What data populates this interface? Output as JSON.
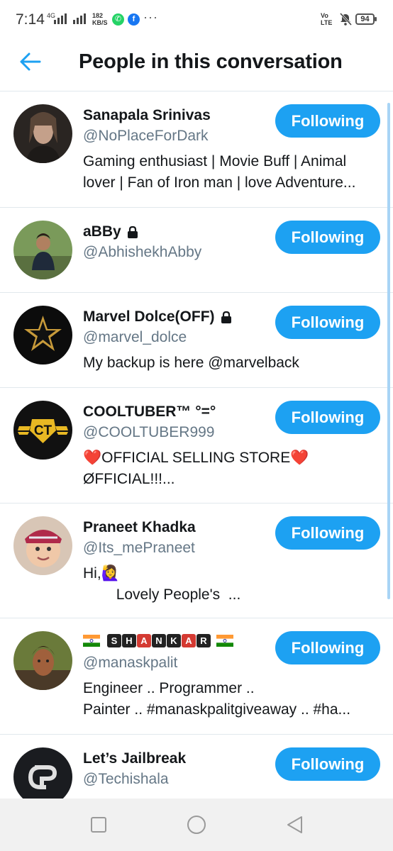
{
  "status_bar": {
    "time": "7:14",
    "network": "4G",
    "speed_value": "182",
    "speed_unit": "KB/S",
    "more": "···",
    "volte_top": "Vo",
    "volte_bottom": "LTE",
    "battery": "94",
    "icons": [
      "whatsapp-icon",
      "facebook-icon",
      "mute-icon",
      "battery-icon"
    ]
  },
  "header": {
    "title": "People in this conversation",
    "back_icon": "arrow-left-icon"
  },
  "accent_color": "#1da1f2",
  "people": [
    {
      "name": "Sanapala Srinivas",
      "handle": "@NoPlaceForDark",
      "bio": "Gaming enthusiast | Movie Buff | Animal\nlover | Fan of Iron man | love Adventure...",
      "button": "Following",
      "protected": false
    },
    {
      "name": "aBBy",
      "handle": "@AbhishekhAbby",
      "bio": "",
      "button": "Following",
      "protected": true
    },
    {
      "name": "Marvel Dolce(OFF)",
      "handle": "@marvel_dolce",
      "bio": "My backup is here @marvelback",
      "button": "Following",
      "protected": true
    },
    {
      "name": "COOLTUBER™ °=°",
      "handle": "@COOLTUBER999",
      "bio": "❤️OFFICIAL SELLING STORE❤️\nØFFICIAL!!!...",
      "button": "Following",
      "protected": false
    },
    {
      "name": "Praneet Khadka",
      "handle": "@Its_mePraneet",
      "bio": "Hi,🙋‍♀️\n        Lovely People's  ...",
      "button": "Following",
      "protected": false
    },
    {
      "name_letters": [
        "S",
        "H",
        "A",
        "N",
        "K",
        "A",
        "R"
      ],
      "handle": "@manaskpalit",
      "bio": "Engineer .. Programmer ..\nPainter .. #manaskpalitgiveaway .. #ha...",
      "button": "Following",
      "protected": false
    },
    {
      "name": "Let’s Jailbreak",
      "handle": "@Techishala",
      "bio": "",
      "button": "Following",
      "protected": false
    }
  ],
  "nav_bar": {
    "icons": [
      "recents-square-icon",
      "home-circle-icon",
      "back-triangle-icon"
    ]
  }
}
